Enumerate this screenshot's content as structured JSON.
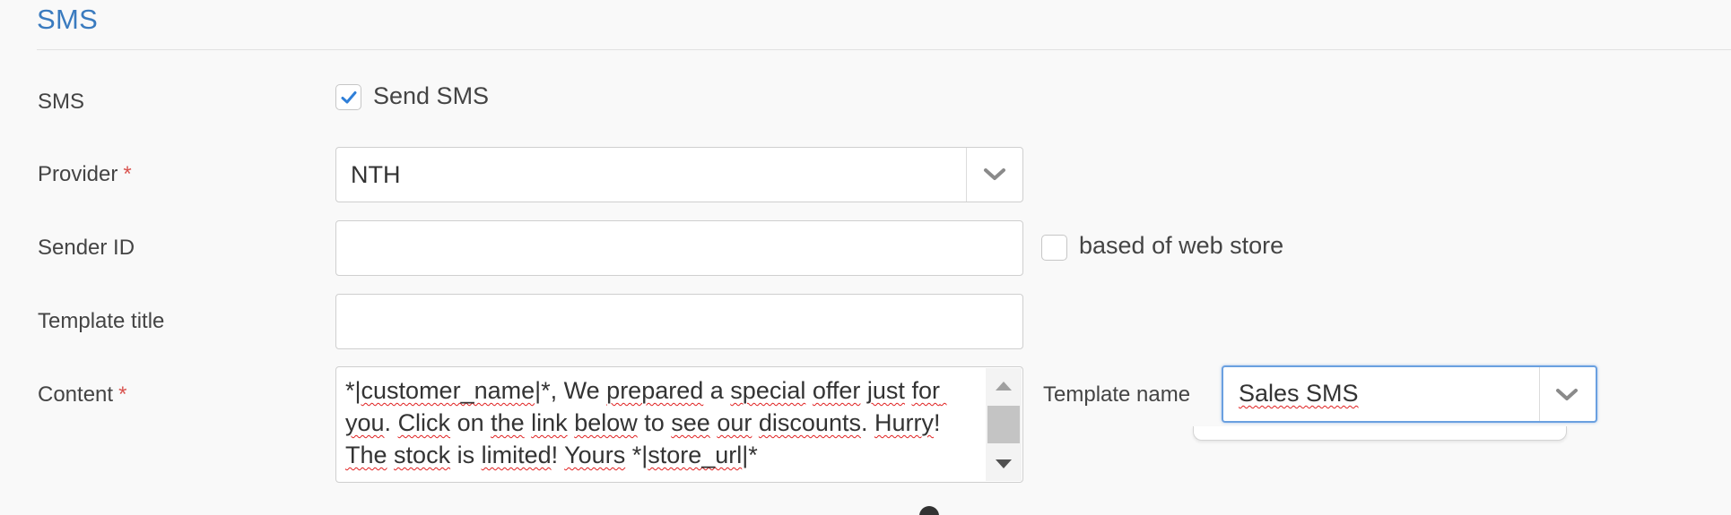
{
  "section": {
    "title": "SMS"
  },
  "sms_row": {
    "label": "SMS",
    "checkbox_label": "Send SMS",
    "checked": true
  },
  "provider_row": {
    "label": "Provider",
    "required_mark": "*",
    "value": "NTH"
  },
  "sender_row": {
    "label": "Sender ID",
    "value": "",
    "web_store_checkbox_label": "based of web store",
    "web_store_checked": false
  },
  "template_title_row": {
    "label": "Template title",
    "value": ""
  },
  "content_row": {
    "label": "Content",
    "required_mark": "*",
    "text_segments": [
      {
        "t": "*|",
        "s": false
      },
      {
        "t": "customer_name",
        "s": true
      },
      {
        "t": "|*, We ",
        "s": false
      },
      {
        "t": "prepared",
        "s": true
      },
      {
        "t": " a ",
        "s": false
      },
      {
        "t": "special",
        "s": true
      },
      {
        "t": " ",
        "s": false
      },
      {
        "t": "offer",
        "s": true
      },
      {
        "t": " ",
        "s": false
      },
      {
        "t": "just",
        "s": true
      },
      {
        "t": " ",
        "s": false
      },
      {
        "t": "for you",
        "s": true
      },
      {
        "t": ". ",
        "s": false
      },
      {
        "t": "Click",
        "s": true
      },
      {
        "t": " on ",
        "s": false
      },
      {
        "t": "the",
        "s": true
      },
      {
        "t": " ",
        "s": false
      },
      {
        "t": "link",
        "s": true
      },
      {
        "t": " ",
        "s": false
      },
      {
        "t": "below",
        "s": true
      },
      {
        "t": " to ",
        "s": false
      },
      {
        "t": "see",
        "s": true
      },
      {
        "t": " ",
        "s": false
      },
      {
        "t": "our",
        "s": true
      },
      {
        "t": " ",
        "s": false
      },
      {
        "t": "discounts",
        "s": true
      },
      {
        "t": ". ",
        "s": false
      },
      {
        "t": "Hurry",
        "s": true
      },
      {
        "t": "! ",
        "s": false
      },
      {
        "t": "The",
        "s": true
      },
      {
        "t": " ",
        "s": false
      },
      {
        "t": "stock",
        "s": true
      },
      {
        "t": " is ",
        "s": false
      },
      {
        "t": "limited",
        "s": true
      },
      {
        "t": "! ",
        "s": false
      },
      {
        "t": "Yours",
        "s": true
      },
      {
        "t": " *|",
        "s": false
      },
      {
        "t": "store_url",
        "s": true
      },
      {
        "t": "|*",
        "s": false
      }
    ]
  },
  "template_name_row": {
    "label": "Template name",
    "value": "Sales SMS"
  },
  "icons": {
    "check": "checkmark-icon",
    "chevron": "chevron-down-icon",
    "scroll_up": "scroll-up-arrow-icon",
    "scroll_down": "scroll-down-arrow-icon",
    "info": "info-icon"
  },
  "colors": {
    "accent": "#3a7bbf",
    "required": "#d9534f",
    "checkmark": "#2f7fd8",
    "focus_border": "#6aa0e0",
    "spellcheck": "#e02020"
  }
}
